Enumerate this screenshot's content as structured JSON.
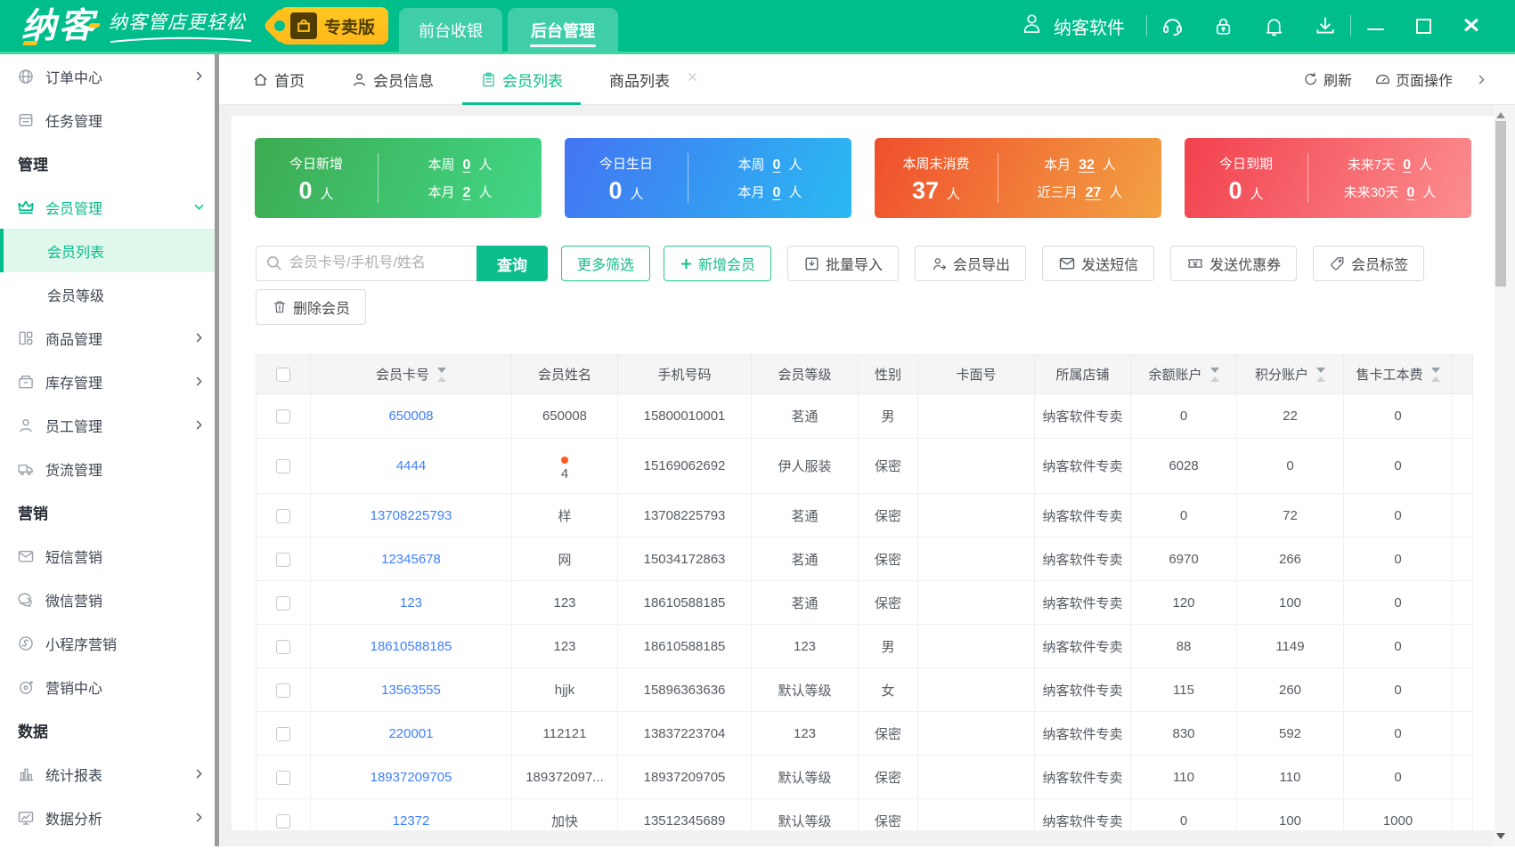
{
  "theme": {
    "green": "#00BE8C",
    "link_blue": "#3E7FFF",
    "badge_yellow": "#FFBE1E"
  },
  "titlebar": {
    "logo": "纳客",
    "slogan": "纳客管店更轻松",
    "badge": "专卖版",
    "mode_tabs": [
      {
        "label": "前台收银",
        "active": false
      },
      {
        "label": "后台管理",
        "active": true
      }
    ],
    "user_name": "纳客软件",
    "icons": [
      "headset-icon",
      "lock-icon",
      "bell-icon",
      "download-icon"
    ],
    "window_controls": [
      "minimize",
      "maximize",
      "close"
    ]
  },
  "sidebar": {
    "items": [
      {
        "type": "item",
        "icon": "globe",
        "label": "订单中心",
        "chevron": "right"
      },
      {
        "type": "item",
        "icon": "task",
        "label": "任务管理"
      },
      {
        "type": "section",
        "label": "管理"
      },
      {
        "type": "item",
        "icon": "crown",
        "label": "会员管理",
        "chevron": "down",
        "active": true
      },
      {
        "type": "sub",
        "label": "会员列表",
        "active": true
      },
      {
        "type": "sub",
        "label": "会员等级"
      },
      {
        "type": "item",
        "icon": "goods",
        "label": "商品管理",
        "chevron": "right"
      },
      {
        "type": "item",
        "icon": "stock",
        "label": "库存管理",
        "chevron": "right"
      },
      {
        "type": "item",
        "icon": "staff",
        "label": "员工管理",
        "chevron": "right"
      },
      {
        "type": "item",
        "icon": "truck",
        "label": "货流管理"
      },
      {
        "type": "section",
        "label": "营销"
      },
      {
        "type": "item",
        "icon": "mail",
        "label": "短信营销"
      },
      {
        "type": "item",
        "icon": "wechat",
        "label": "微信营销"
      },
      {
        "type": "item",
        "icon": "miniapp",
        "label": "小程序营销"
      },
      {
        "type": "item",
        "icon": "target",
        "label": "营销中心"
      },
      {
        "type": "section",
        "label": "数据"
      },
      {
        "type": "item",
        "icon": "chart",
        "label": "统计报表",
        "chevron": "right"
      },
      {
        "type": "item",
        "icon": "monitor",
        "label": "数据分析",
        "chevron": "right"
      }
    ]
  },
  "page_tabs": [
    {
      "label": "首页",
      "icon": "home",
      "active": false
    },
    {
      "label": "会员信息",
      "icon": "person",
      "active": false
    },
    {
      "label": "会员列表",
      "icon": "clipboard",
      "active": true
    },
    {
      "label": "商品列表",
      "icon": "",
      "active": false,
      "closable": true
    }
  ],
  "tab_actions": {
    "refresh": "刷新",
    "page_ops": "页面操作"
  },
  "stats": [
    {
      "title": "今日新增",
      "big": "0",
      "unit": "人",
      "rows": [
        {
          "label": "本周",
          "value": "0",
          "unit": "人"
        },
        {
          "label": "本月",
          "value": "2",
          "unit": "人"
        }
      ],
      "gradient": [
        "#3EAB51",
        "#40D787"
      ]
    },
    {
      "title": "今日生日",
      "big": "0",
      "unit": "人",
      "rows": [
        {
          "label": "本周",
          "value": "0",
          "unit": "人"
        },
        {
          "label": "本月",
          "value": "0",
          "unit": "人"
        }
      ],
      "gradient": [
        "#4374F2",
        "#2ABAF2"
      ]
    },
    {
      "title": "本周未消费",
      "big": "37",
      "unit": "人",
      "rows": [
        {
          "label": "本月",
          "value": "32",
          "unit": "人"
        },
        {
          "label": "近三月",
          "value": "27",
          "unit": "人"
        }
      ],
      "gradient": [
        "#F04F2D",
        "#F2A243"
      ]
    },
    {
      "title": "今日到期",
      "big": "0",
      "unit": "人",
      "rows": [
        {
          "label": "未来7天",
          "value": "0",
          "unit": "人"
        },
        {
          "label": "未来30天",
          "value": "0",
          "unit": "人"
        }
      ],
      "gradient": [
        "#F2414D",
        "#FB8E8F"
      ]
    }
  ],
  "search": {
    "placeholder": "会员卡号/手机号/姓名",
    "button": "查询"
  },
  "toolbar_buttons": [
    {
      "label": "更多筛选",
      "style": "outline-green",
      "icon": ""
    },
    {
      "label": "新增会员",
      "style": "outline-green",
      "icon": "plus"
    },
    {
      "label": "批量导入",
      "style": "gray",
      "icon": "import"
    },
    {
      "label": "会员导出",
      "style": "gray",
      "icon": "export"
    },
    {
      "label": "发送短信",
      "style": "gray",
      "icon": "mail"
    },
    {
      "label": "发送优惠券",
      "style": "gray",
      "icon": "coupon"
    },
    {
      "label": "会员标签",
      "style": "gray",
      "icon": "tag"
    }
  ],
  "toolbar_buttons_row2": [
    {
      "label": "删除会员",
      "style": "gray",
      "icon": "trash"
    }
  ],
  "table": {
    "columns": [
      {
        "label": "",
        "key": "checkbox"
      },
      {
        "label": "会员卡号",
        "sortable": true
      },
      {
        "label": "会员姓名"
      },
      {
        "label": "手机号码"
      },
      {
        "label": "会员等级"
      },
      {
        "label": "性别"
      },
      {
        "label": "卡面号"
      },
      {
        "label": "所属店铺"
      },
      {
        "label": "余额账户",
        "sortable": true
      },
      {
        "label": "积分账户",
        "sortable": true
      },
      {
        "label": "售卡工本费",
        "sortable": true
      },
      {
        "label": ""
      }
    ],
    "rows": [
      {
        "card_no": "650008",
        "name": "650008",
        "phone": "15800010001",
        "level": "茗通",
        "gender": "男",
        "card_face": "",
        "store": "纳客软件专卖",
        "balance": "0",
        "points": "22",
        "card_fee": "0"
      },
      {
        "card_no": "4444",
        "name": "4",
        "name_dot": true,
        "phone": "15169062692",
        "level": "伊人服装",
        "gender": "保密",
        "card_face": "",
        "store": "纳客软件专卖",
        "balance": "6028",
        "points": "0",
        "card_fee": "0"
      },
      {
        "card_no": "13708225793",
        "name": "样",
        "phone": "13708225793",
        "level": "茗通",
        "gender": "保密",
        "card_face": "",
        "store": "纳客软件专卖",
        "balance": "0",
        "points": "72",
        "card_fee": "0"
      },
      {
        "card_no": "12345678",
        "name": "网",
        "phone": "15034172863",
        "level": "茗通",
        "gender": "保密",
        "card_face": "",
        "store": "纳客软件专卖",
        "balance": "6970",
        "points": "266",
        "card_fee": "0"
      },
      {
        "card_no": "123",
        "name": "123",
        "phone": "18610588185",
        "level": "茗通",
        "gender": "保密",
        "card_face": "",
        "store": "纳客软件专卖",
        "balance": "120",
        "points": "100",
        "card_fee": "0"
      },
      {
        "card_no": "18610588185",
        "name": "123",
        "phone": "18610588185",
        "level": "123",
        "gender": "男",
        "card_face": "",
        "store": "纳客软件专卖",
        "balance": "88",
        "points": "1149",
        "card_fee": "0"
      },
      {
        "card_no": "13563555",
        "name": "hjjk",
        "phone": "15896363636",
        "level": "默认等级",
        "gender": "女",
        "card_face": "",
        "store": "纳客软件专卖",
        "balance": "115",
        "points": "260",
        "card_fee": "0"
      },
      {
        "card_no": "220001",
        "name": "112121",
        "phone": "13837223704",
        "level": "123",
        "gender": "保密",
        "card_face": "",
        "store": "纳客软件专卖",
        "balance": "830",
        "points": "592",
        "card_fee": "0"
      },
      {
        "card_no": "18937209705",
        "name": "189372097...",
        "phone": "18937209705",
        "level": "默认等级",
        "gender": "保密",
        "card_face": "",
        "store": "纳客软件专卖",
        "balance": "110",
        "points": "110",
        "card_fee": "0"
      },
      {
        "card_no": "12372",
        "name": "加快",
        "phone": "13512345689",
        "level": "默认等级",
        "gender": "保密",
        "card_face": "",
        "store": "纳客软件专卖",
        "balance": "0",
        "points": "100",
        "card_fee": "1000"
      }
    ]
  }
}
